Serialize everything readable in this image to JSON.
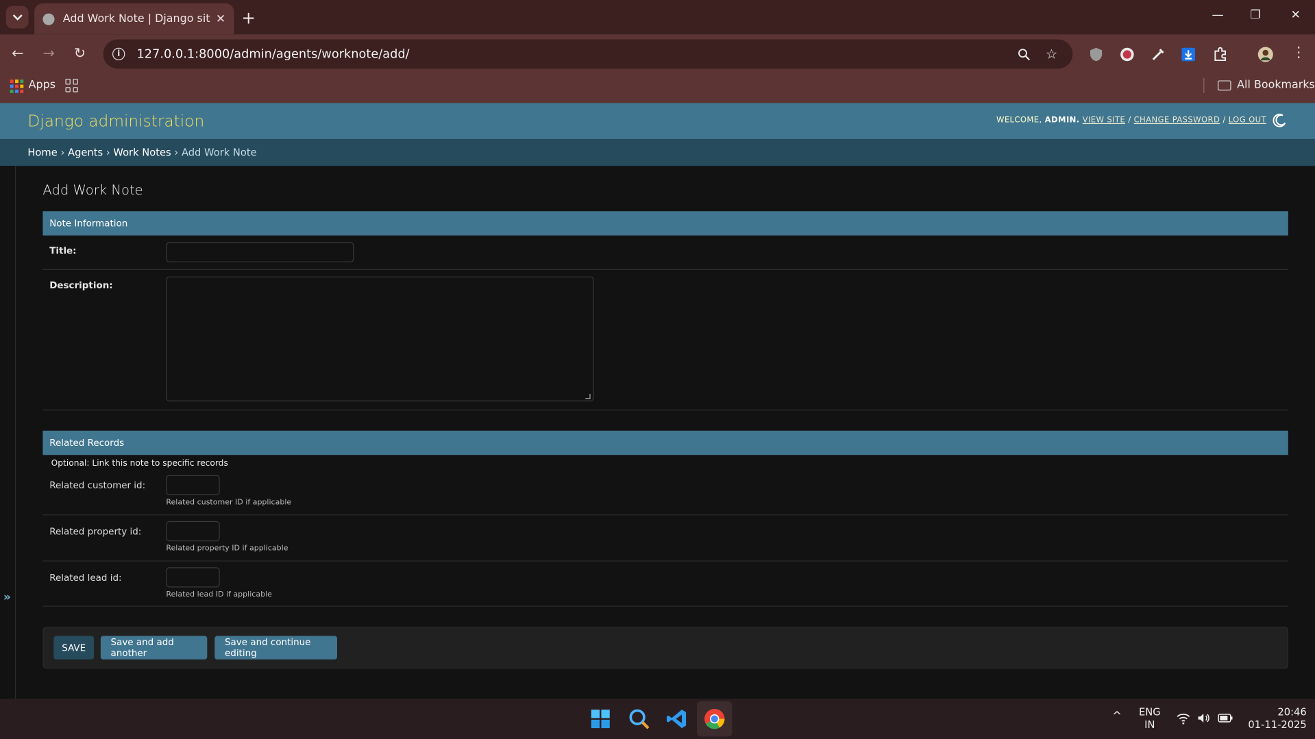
{
  "browser": {
    "tab_title": "Add Work Note | Django site ac",
    "url": "127.0.0.1:8000/admin/agents/worknote/add/",
    "bookmarks": {
      "apps_label": "Apps",
      "all_bookmarks_label": "All Bookmarks"
    }
  },
  "header": {
    "branding": "Django administration",
    "welcome": "WELCOME,",
    "username": "ADMIN.",
    "view_site": "VIEW SITE",
    "change_password": "CHANGE PASSWORD",
    "log_out": "LOG OUT",
    "sep": "/"
  },
  "breadcrumbs": {
    "home": "Home",
    "app": "Agents",
    "model": "Work Notes",
    "current": "Add Work Note",
    "sep": "›"
  },
  "page": {
    "title": "Add Work Note",
    "sections": {
      "note_info": {
        "heading": "Note Information",
        "title_label": "Title:",
        "title_value": "",
        "description_label": "Description:",
        "description_value": ""
      },
      "related": {
        "heading": "Related Records",
        "description": "Optional: Link this note to specific records",
        "customer_label": "Related customer id:",
        "customer_help": "Related customer ID if applicable",
        "property_label": "Related property id:",
        "property_help": "Related property ID if applicable",
        "lead_label": "Related lead id:",
        "lead_help": "Related lead ID if applicable"
      }
    },
    "buttons": {
      "save": "SAVE",
      "save_add_another": "Save and add another",
      "save_continue": "Save and continue editing"
    },
    "sidebar_toggle": "»"
  },
  "taskbar": {
    "lang_top": "ENG",
    "lang_bottom": "IN",
    "time": "20:46",
    "date": "01-11-2025"
  },
  "colors": {
    "header_bg": "#417690",
    "breadcrumb_bg": "#264b5d",
    "branding": "#f5dd5d",
    "save_button": "#264b5d"
  }
}
